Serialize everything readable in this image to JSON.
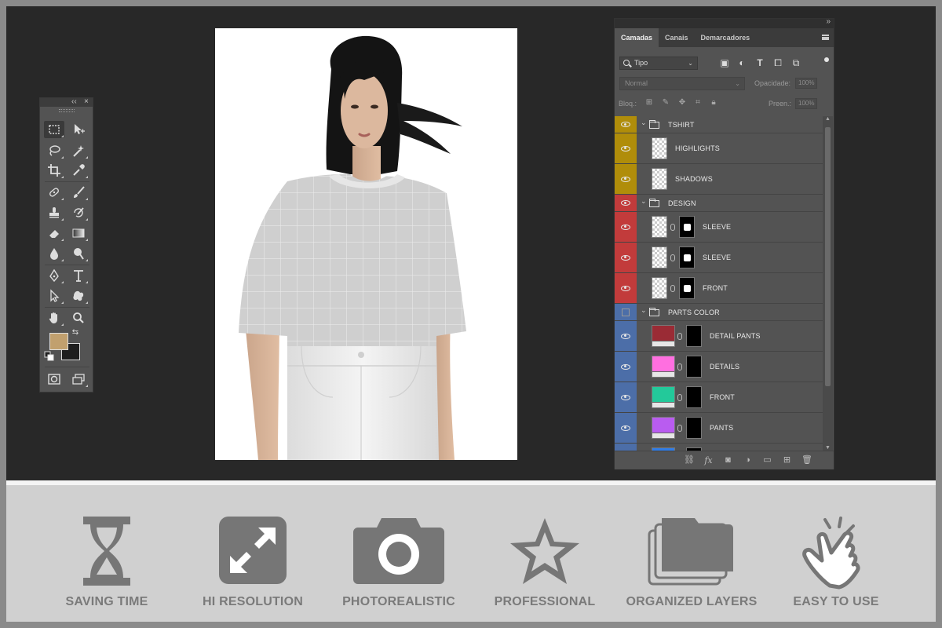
{
  "layers_panel": {
    "tabs": [
      "Camadas",
      "Canais",
      "Demarcadores"
    ],
    "filter": {
      "kind_label": "Tipo"
    },
    "blend_mode": "Normal",
    "opacity_label": "Opacidade:",
    "opacity_value": "100%",
    "lock_label": "Bloq.:",
    "fill_label": "Preen.:",
    "fill_value": "100%",
    "layers": [
      {
        "name": "TSHIRT",
        "type": "group",
        "label_color": "#b08d0a",
        "visible": true
      },
      {
        "name": "HIGHLIGHTS",
        "type": "layer",
        "label_color": "#b08d0a",
        "visible": true
      },
      {
        "name": "SHADOWS",
        "type": "layer",
        "label_color": "#b08d0a",
        "visible": true
      },
      {
        "name": "DESIGN",
        "type": "group",
        "label_color": "#c23b3b",
        "visible": true
      },
      {
        "name": "SLEEVE",
        "type": "smart_object_masked",
        "label_color": "#c23b3b",
        "visible": true
      },
      {
        "name": "SLEEVE",
        "type": "smart_object_masked",
        "label_color": "#c23b3b",
        "visible": true
      },
      {
        "name": "FRONT",
        "type": "smart_object_masked",
        "label_color": "#c23b3b",
        "visible": true
      },
      {
        "name": "PARTS COLOR",
        "type": "group",
        "label_color": "#4c6ea8",
        "visible": false
      },
      {
        "name": "DETAIL PANTS",
        "type": "fill_masked",
        "label_color": "#4c6ea8",
        "swatch": "#9a2b35",
        "visible": true
      },
      {
        "name": "DETAILS",
        "type": "fill_masked",
        "label_color": "#4c6ea8",
        "swatch": "#ff6fe0",
        "visible": true
      },
      {
        "name": "FRONT",
        "type": "fill_masked",
        "label_color": "#4c6ea8",
        "swatch": "#23c99a",
        "visible": true
      },
      {
        "name": "PANTS",
        "type": "fill_masked",
        "label_color": "#4c6ea8",
        "swatch": "#b95cf0",
        "visible": true
      },
      {
        "name": "",
        "type": "fill_masked",
        "label_color": "#4c6ea8",
        "swatch": "#2f7de8",
        "visible": true
      }
    ]
  },
  "toolbox": {
    "foreground_color": "#c1a06e",
    "background_color": "#1e1e1e"
  },
  "features": [
    {
      "label": "SAVING TIME",
      "icon": "hourglass-icon"
    },
    {
      "label": "HI RESOLUTION",
      "icon": "expand-arrows-icon"
    },
    {
      "label": "PHOTOREALISTIC",
      "icon": "camera-icon"
    },
    {
      "label": "PROFESSIONAL",
      "icon": "star-icon"
    },
    {
      "label": "ORGANIZED LAYERS",
      "icon": "layers-stack-icon"
    },
    {
      "label": "EASY TO USE",
      "icon": "tap-hand-icon"
    }
  ]
}
